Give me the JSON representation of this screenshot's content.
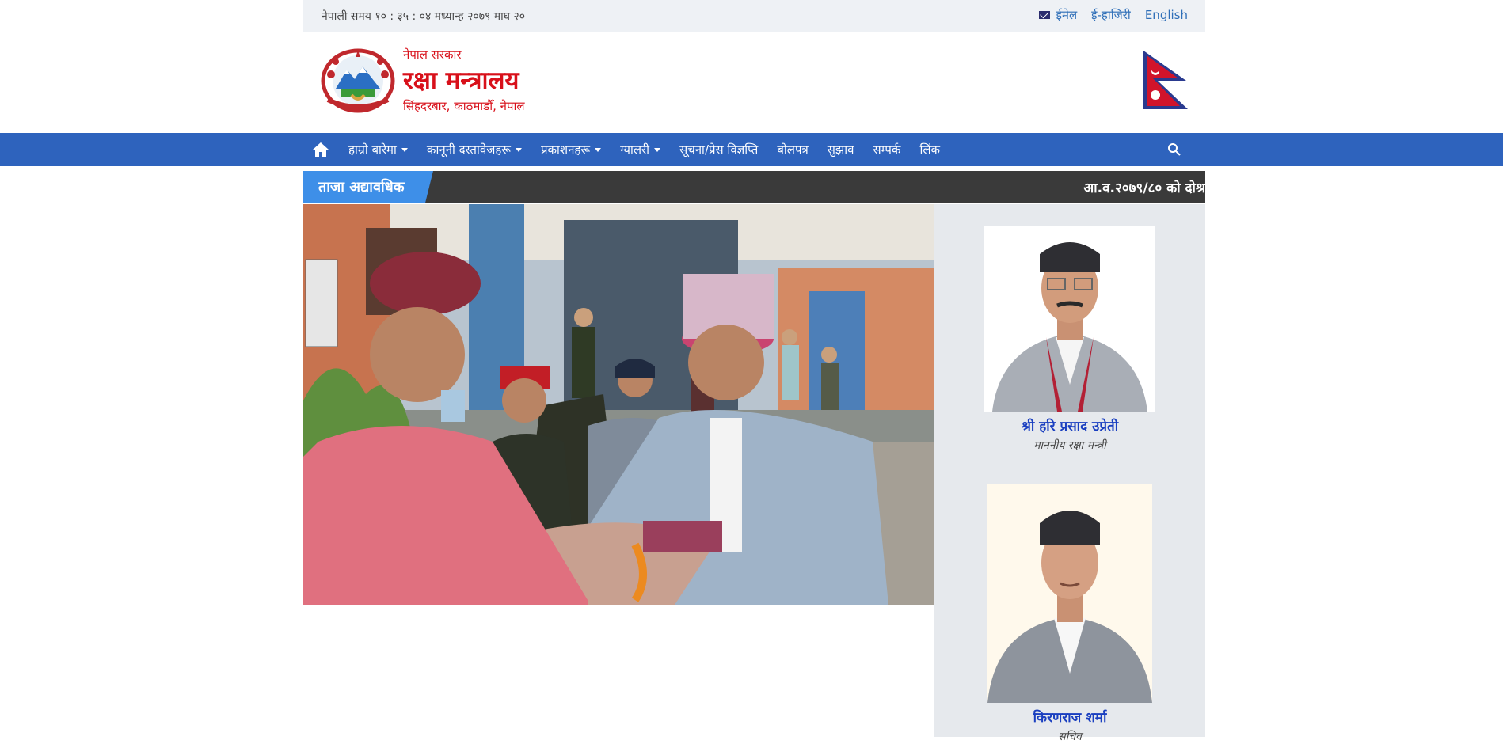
{
  "topbar": {
    "time_text": "नेपाली समय १० : ३५ : ०४ मध्यान्ह   २०७९ माघ २०",
    "email_label": "ईमेल",
    "ehajiri_label": "ई-हाजिरी",
    "english_label": "English"
  },
  "header": {
    "gov_label": "नेपाल सरकार",
    "ministry_title": "रक्षा मन्त्रालय",
    "address": "सिंहदरबार, काठमाडौँ, नेपाल"
  },
  "nav": {
    "items": [
      {
        "label": "हाम्रो बारेमा",
        "dropdown": true
      },
      {
        "label": "कानूनी दस्तावेजहरू",
        "dropdown": true
      },
      {
        "label": "प्रकाशनहरू",
        "dropdown": true
      },
      {
        "label": "ग्यालरी",
        "dropdown": true
      },
      {
        "label": "सूचना/प्रेस विज्ञप्ति",
        "dropdown": false
      },
      {
        "label": "बोलपत्र",
        "dropdown": false
      },
      {
        "label": "सुझाव",
        "dropdown": false
      },
      {
        "label": "सम्पर्क",
        "dropdown": false
      },
      {
        "label": "लिंक",
        "dropdown": false
      }
    ]
  },
  "ticker": {
    "label": "ताजा अद्यावधिक",
    "news": "आ.व.२०७९/८० को दोश्र"
  },
  "sidebar": {
    "people": [
      {
        "name": "श्री हरि प्रसाद उप्रेती",
        "role": "माननीय रक्षा मन्त्री"
      },
      {
        "name": "किरणराज शर्मा",
        "role": "सचिव"
      }
    ]
  },
  "colors": {
    "nav_bg": "#2e63bd",
    "ticker_label_bg": "#3e8fe8",
    "title_red": "#d8101a",
    "link_blue": "#2f6fb8",
    "sidebar_bg": "#e6e9ed"
  }
}
